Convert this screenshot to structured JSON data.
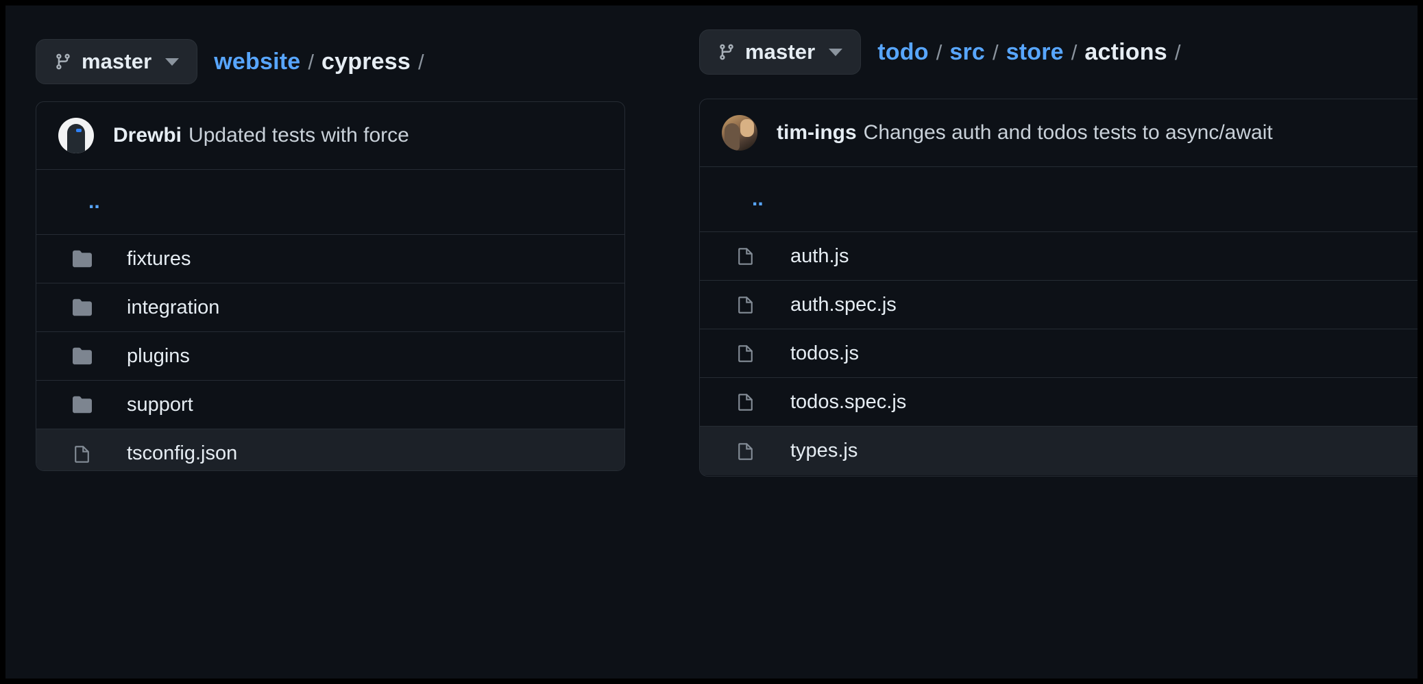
{
  "colors": {
    "background": "#0d1117",
    "panel_border": "#262c34",
    "link_blue": "#58a6ff",
    "text_primary": "#e6edf3",
    "text_muted": "#8b949e",
    "branch_button_bg": "#21262d",
    "row_highlight": "#1c2128",
    "folder_icon": "#7d8590",
    "file_icon": "#848d97",
    "outer_border": "#000000"
  },
  "panels": [
    {
      "id": "left",
      "branch": {
        "icon": "git-branch-icon",
        "label": "master",
        "caret": "chevron-down-icon"
      },
      "breadcrumb": [
        {
          "text": "website",
          "type": "link"
        },
        {
          "text": "/",
          "type": "separator"
        },
        {
          "text": "cypress",
          "type": "current"
        },
        {
          "text": "/",
          "type": "separator"
        }
      ],
      "commit": {
        "avatar": "avatar-drewbi",
        "author": "Drewbi",
        "message": "Updated tests with force"
      },
      "parent_link": "..",
      "entries": [
        {
          "name": "fixtures",
          "kind": "folder",
          "highlighted": false
        },
        {
          "name": "integration",
          "kind": "folder",
          "highlighted": false
        },
        {
          "name": "plugins",
          "kind": "folder",
          "highlighted": false
        },
        {
          "name": "support",
          "kind": "folder",
          "highlighted": false
        },
        {
          "name": "tsconfig.json",
          "kind": "file",
          "highlighted": true
        }
      ]
    },
    {
      "id": "right",
      "branch": {
        "icon": "git-branch-icon",
        "label": "master",
        "caret": "chevron-down-icon"
      },
      "breadcrumb": [
        {
          "text": "todo",
          "type": "link"
        },
        {
          "text": "/",
          "type": "separator"
        },
        {
          "text": "src",
          "type": "link"
        },
        {
          "text": "/",
          "type": "separator"
        },
        {
          "text": "store",
          "type": "link"
        },
        {
          "text": "/",
          "type": "separator"
        },
        {
          "text": "actions",
          "type": "current"
        },
        {
          "text": "/",
          "type": "separator"
        }
      ],
      "commit": {
        "avatar": "avatar-tim",
        "author": "tim-ings",
        "message": "Changes auth and todos tests to async/await"
      },
      "parent_link": "..",
      "entries": [
        {
          "name": "auth.js",
          "kind": "file",
          "highlighted": false
        },
        {
          "name": "auth.spec.js",
          "kind": "file",
          "highlighted": false
        },
        {
          "name": "todos.js",
          "kind": "file",
          "highlighted": false
        },
        {
          "name": "todos.spec.js",
          "kind": "file",
          "highlighted": false
        },
        {
          "name": "types.js",
          "kind": "file",
          "highlighted": true
        }
      ]
    }
  ]
}
